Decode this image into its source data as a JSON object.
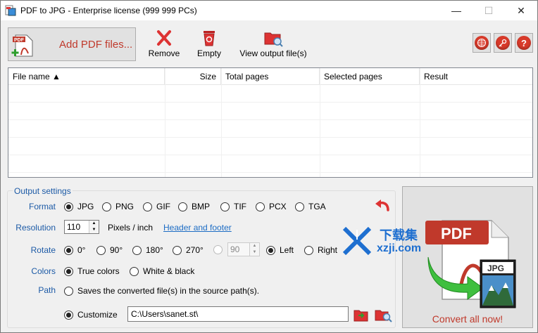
{
  "window": {
    "title": "PDF to JPG - Enterprise license (999 999 PCs)",
    "minimize": "—",
    "maximize": "☐",
    "close": "✕"
  },
  "toolbar": {
    "add_pdf_label": "Add PDF files...",
    "remove_label": "Remove",
    "empty_label": "Empty",
    "view_output_label": "View output file(s)",
    "right_icons": [
      "globe-icon",
      "key-icon",
      "help-icon"
    ]
  },
  "file_list": {
    "columns": [
      "File name ▲",
      "Size",
      "Total pages",
      "Selected pages",
      "Result"
    ],
    "rows": []
  },
  "settings": {
    "group_title": "Output settings",
    "format_label": "Format",
    "formats": [
      "JPG",
      "PNG",
      "GIF",
      "BMP",
      "TIF",
      "PCX",
      "TGA"
    ],
    "format_selected": "JPG",
    "resolution_label": "Resolution",
    "resolution_value": "110",
    "resolution_unit": "Pixels / inch",
    "header_footer_link": "Header and footer",
    "rotate_label": "Rotate",
    "rotations": [
      "0°",
      "90°",
      "180°",
      "270°"
    ],
    "rotate_selected": "0°",
    "rotate_custom_value": "90",
    "directions": [
      "Left",
      "Right"
    ],
    "direction_selected": "Left",
    "colors_label": "Colors",
    "colors": [
      "True colors",
      "White & black"
    ],
    "colors_selected": "True colors",
    "path_label": "Path",
    "path_source_option": "Saves the converted file(s) in the source path(s).",
    "path_custom_option": "Customize",
    "path_selected": "Customize",
    "path_value": "C:\\Users\\sanet.st\\"
  },
  "convert": {
    "label": "Convert all now!",
    "badge_pdf": "PDF",
    "badge_jpg": "JPG"
  },
  "watermark": {
    "text_cn": "下载集",
    "text_url": "xzji.com"
  },
  "colors": {
    "accent_red": "#c0392b",
    "label_blue": "#1c5aa6",
    "link_blue": "#1c6cc4"
  }
}
